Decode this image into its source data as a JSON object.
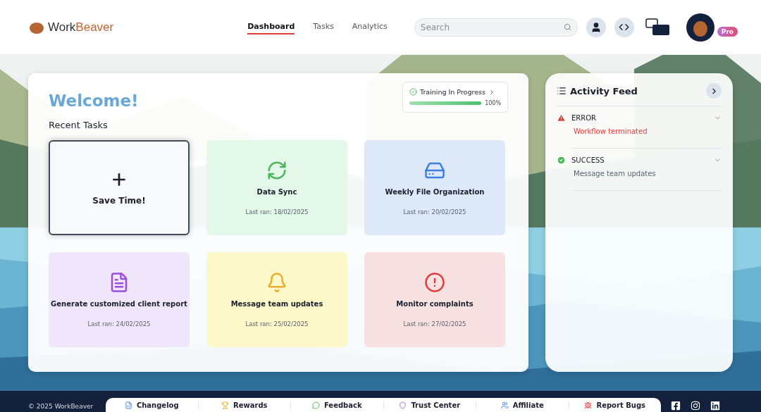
{
  "header": {
    "logo": {
      "part1": "Work",
      "part2": "Beaver"
    },
    "nav": [
      {
        "label": "Dashboard",
        "selected": true
      },
      {
        "label": "Tasks",
        "selected": false
      },
      {
        "label": "Analytics",
        "selected": false
      }
    ],
    "search": {
      "placeholder": "Search"
    },
    "badge": "Pro"
  },
  "main": {
    "title": "Welcome!",
    "subtitle": "Recent Tasks",
    "training": {
      "label": "Training In Progress",
      "level": 1,
      "reading": "100%"
    },
    "tasks": [
      {
        "kind": "add",
        "title": "Save Time!"
      },
      {
        "kind": "sync",
        "title": "Data Sync",
        "last_ran": "Last ran: 18/02/2025",
        "color": "#e3f8e8"
      },
      {
        "kind": "drive",
        "title": "Weekly File Organization",
        "last_ran": "Last ran: 20/02/2025",
        "color": "#dde8f9"
      },
      {
        "kind": "document",
        "title": "Generate customized client report",
        "last_ran": "Last ran: 24/02/2025",
        "color": "#f0e6fc"
      },
      {
        "kind": "bell",
        "title": "Message team updates",
        "last_ran": "Last ran: 25/02/2025",
        "color": "#fdf8c9"
      },
      {
        "kind": "alert",
        "title": "Monitor complaints",
        "last_ran": "Last ran: 27/02/2025",
        "color": "#f8e1e1"
      }
    ]
  },
  "activity": {
    "title": "Activity Feed",
    "items": [
      {
        "kind": "error",
        "status": "ERROR",
        "message": "Workflow terminated"
      },
      {
        "kind": "success",
        "status": "SUCCESS",
        "message": "Message team updates"
      }
    ]
  },
  "footer": {
    "copyright": "© 2025 WorkBeaver",
    "links": [
      {
        "kind": "changelog",
        "label": "Changelog"
      },
      {
        "kind": "rewards",
        "label": "Rewards"
      },
      {
        "kind": "feedback",
        "label": "Feedback"
      },
      {
        "kind": "trust",
        "label": "Trust Center"
      },
      {
        "kind": "affiliate",
        "label": "Affiliate"
      },
      {
        "kind": "bugs",
        "label": "Report Bugs"
      }
    ]
  }
}
